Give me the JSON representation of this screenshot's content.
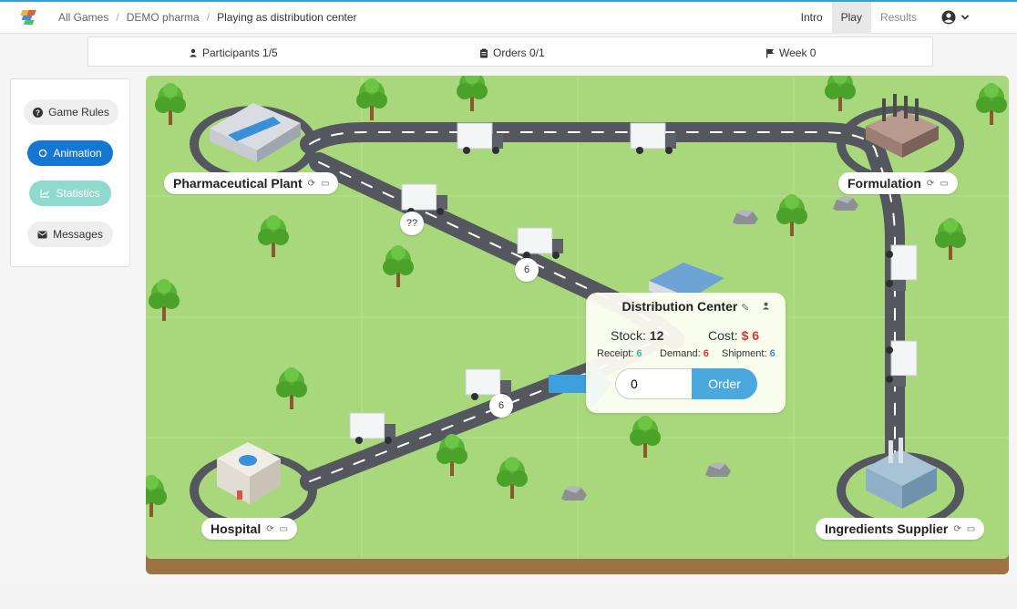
{
  "breadcrumb": {
    "all_games": "All Games",
    "game": "DEMO pharma",
    "current": "Playing as distribution center"
  },
  "nav": {
    "intro": "Intro",
    "play": "Play",
    "results": "Results"
  },
  "infobar": {
    "participants": "Participants 1/5",
    "orders": "Orders 0/1",
    "week": "Week 0"
  },
  "sidebar": {
    "rules": "Game Rules",
    "animation": "Animation",
    "statistics": "Statistics",
    "messages": "Messages"
  },
  "nodes": {
    "plant": "Pharmaceutical Plant",
    "formulation": "Formulation",
    "hospital": "Hospital",
    "supplier": "Ingredients Supplier"
  },
  "truck_badges": {
    "t1": "??",
    "t2": "6",
    "t3": "6"
  },
  "popup": {
    "title": "Distribution Center",
    "stock_label": "Stock:",
    "stock_value": "12",
    "cost_label": "Cost:",
    "cost_value": "$ 6",
    "receipt_label": "Receipt:",
    "receipt_value": "6",
    "demand_label": "Demand:",
    "demand_value": "6",
    "shipment_label": "Shipment:",
    "shipment_value": "6",
    "order_value": "0",
    "order_button": "Order"
  },
  "colors": {
    "accent": "#39a0d6",
    "grass": "#a9d87c",
    "road": "#54585e",
    "cost": "#e0342c",
    "receipt": "#35b8a8"
  }
}
